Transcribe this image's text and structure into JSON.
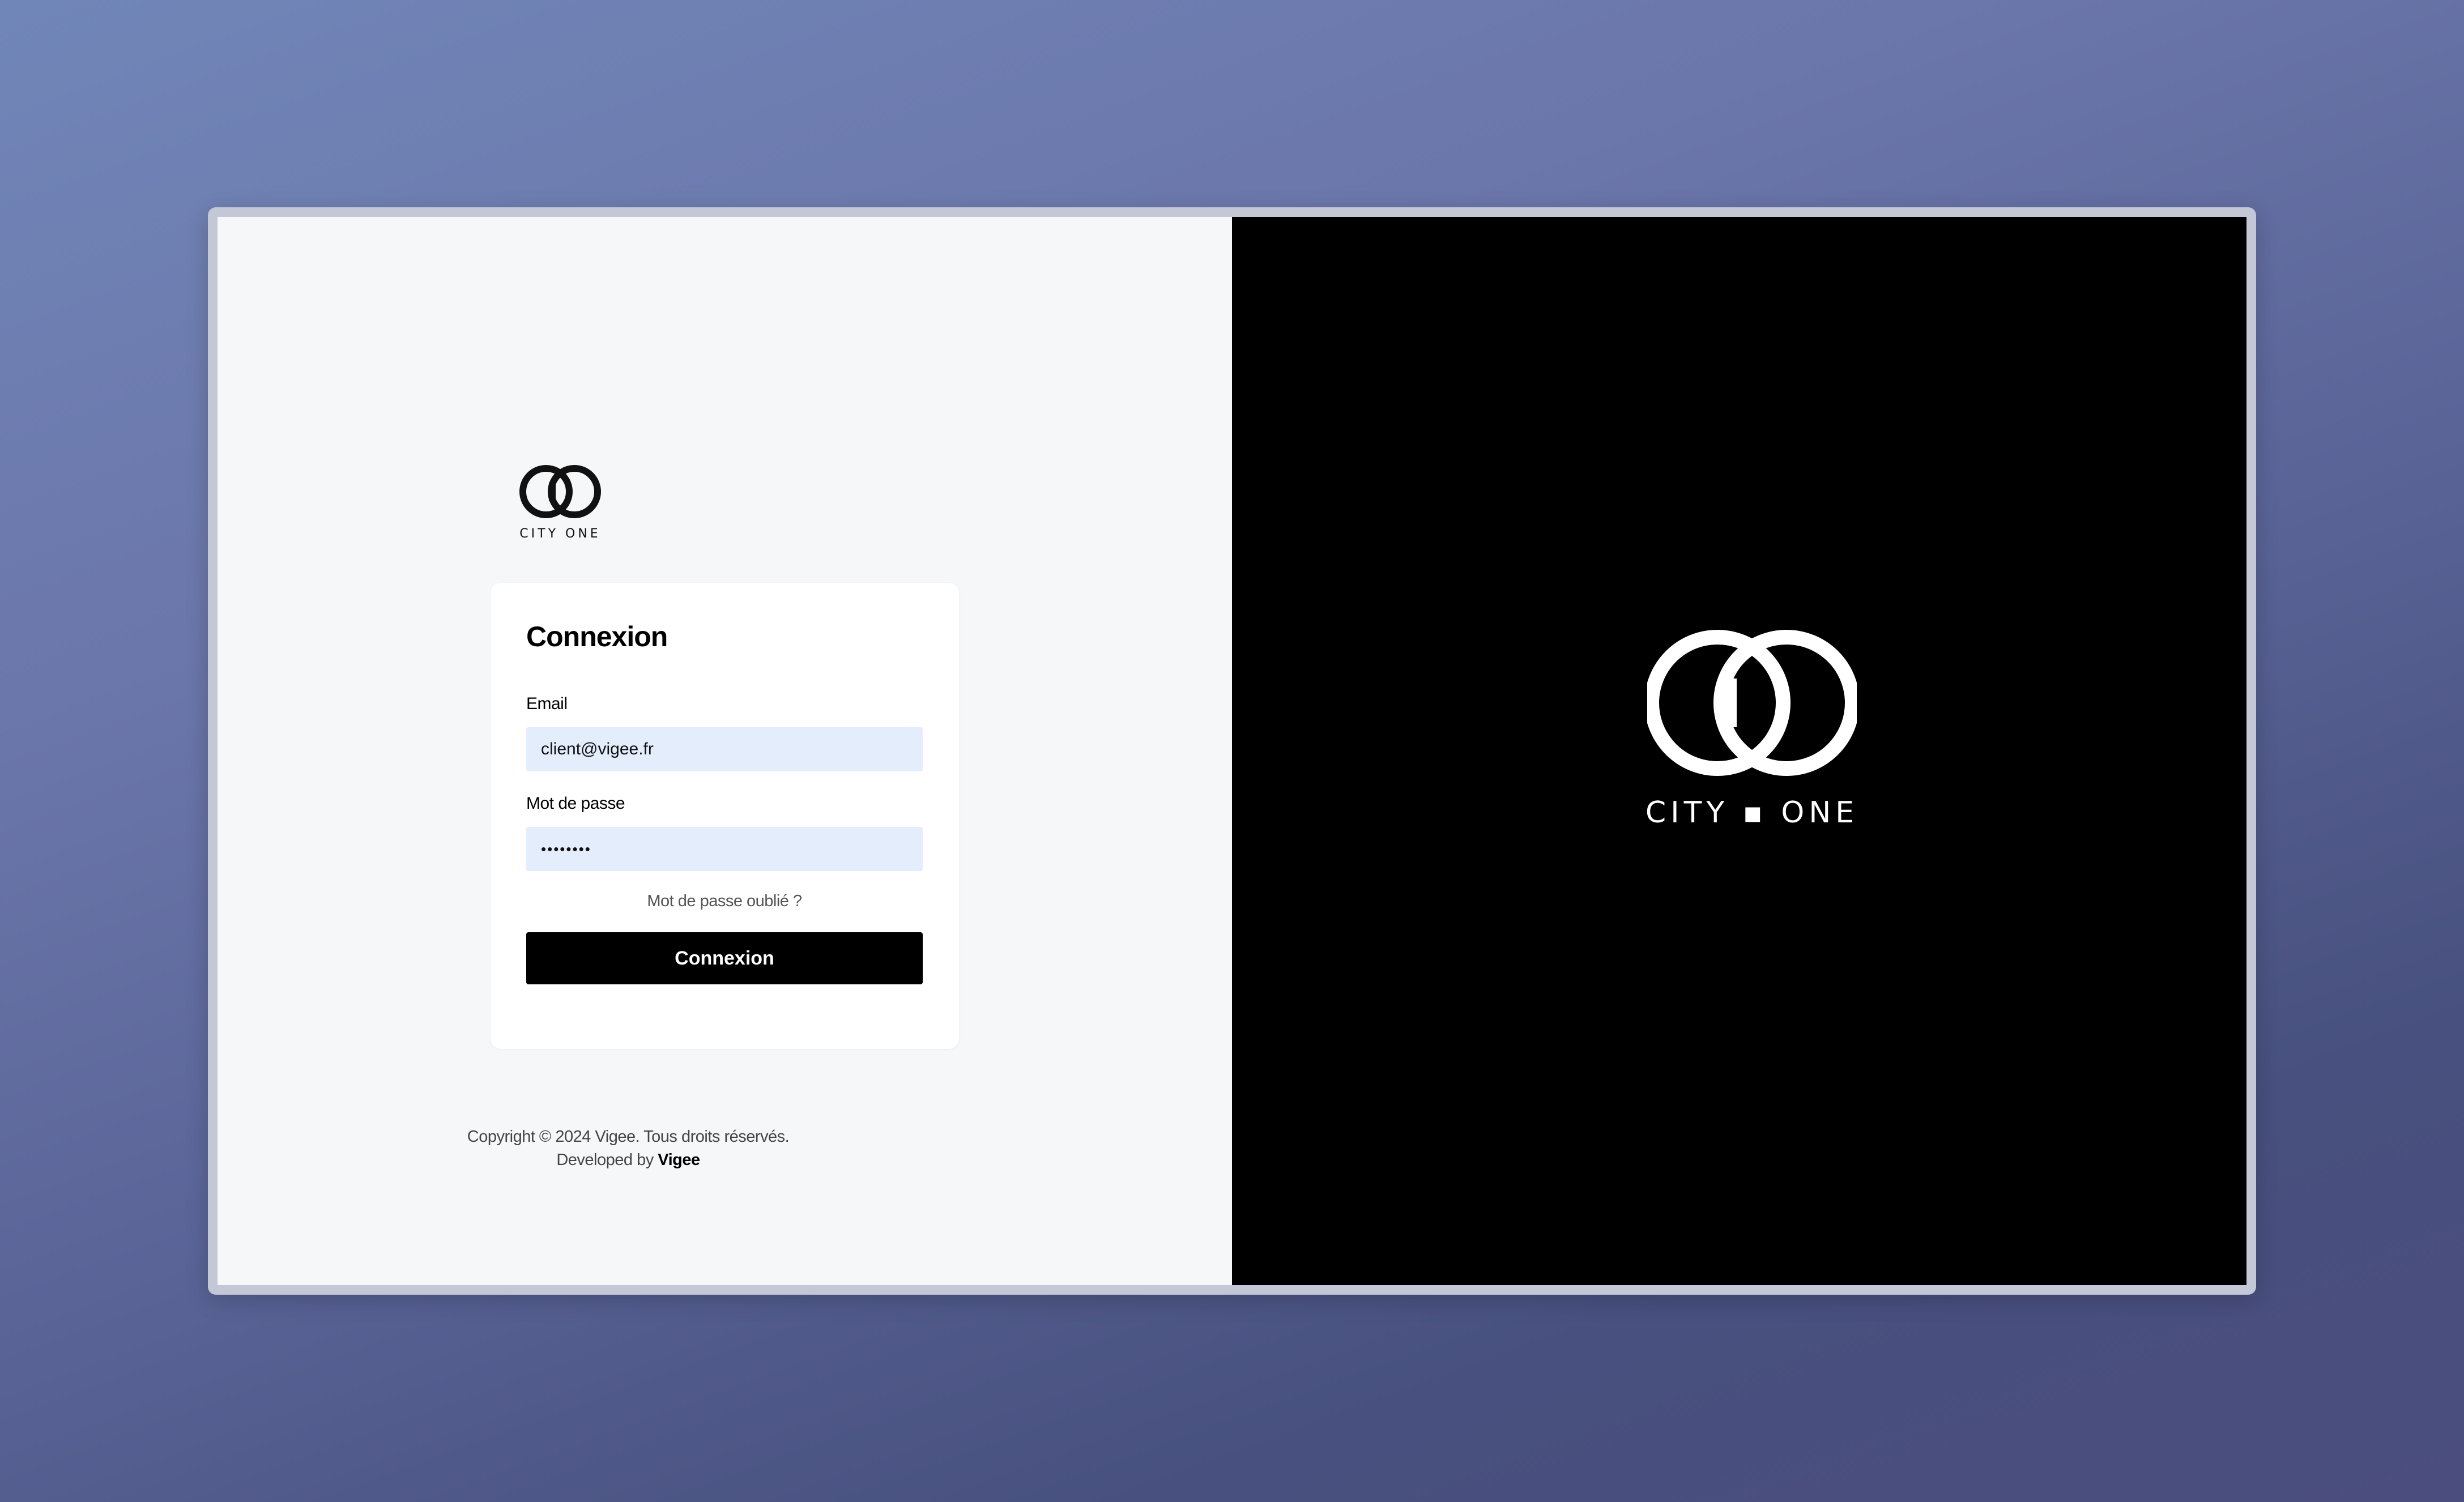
{
  "brand": {
    "name_small": "CITY ONE",
    "name_large": "CITY ▪ ONE"
  },
  "login": {
    "title": "Connexion",
    "email_label": "Email",
    "email_value": "client@vigee.fr",
    "password_label": "Mot de passe",
    "password_value": "••••••••",
    "forgot_link": "Mot de passe oublié ?",
    "submit_label": "Connexion"
  },
  "footer": {
    "copyright": "Copyright © 2024 Vigee. Tous droits réservés.",
    "developed_prefix": "Developed by ",
    "developer": "Vigee"
  },
  "icons": {
    "logo": "city-one-logo-icon"
  },
  "colors": {
    "primary": "#000000",
    "input_bg": "#e4edfc",
    "left_bg": "#f6f7f9",
    "right_bg": "#000000"
  }
}
